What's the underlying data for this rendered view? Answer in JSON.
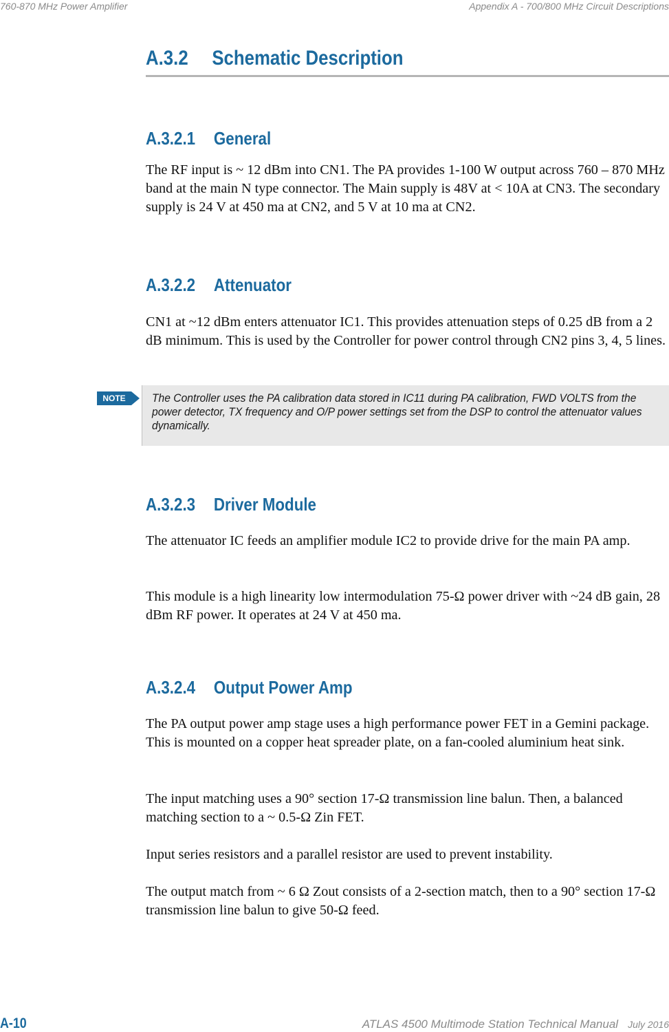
{
  "header": {
    "left": "760-870 MHz Power Amplifier",
    "right": "Appendix A - 700/800 MHz Circuit Descriptions"
  },
  "section": {
    "number": "A.3.2",
    "title": "Schematic Description"
  },
  "subsections": [
    {
      "number": "A.3.2.1",
      "title": "General",
      "paragraphs": [
        "The RF input is ~ 12 dBm into CN1. The PA provides 1-100 W output across 760 – 870 MHz band at the main N type connector. The Main supply is 48V at < 10A at CN3. The secondary supply is 24 V at 450 ma at CN2, and 5 V at 10 ma at CN2."
      ]
    },
    {
      "number": "A.3.2.2",
      "title": "Attenuator",
      "paragraphs": [
        "CN1 at ~12 dBm enters attenuator IC1. This provides attenuation steps of 0.25 dB from a 2 dB minimum. This is used by the Controller for power control through CN2 pins 3, 4, 5 lines."
      ],
      "note": {
        "label": "NOTE",
        "text": "The Controller uses the PA calibration data stored in IC11 during PA calibration, FWD VOLTS from the power detector, TX frequency and O/P power settings set from the DSP to control the attenuator values dynamically."
      }
    },
    {
      "number": "A.3.2.3",
      "title": "Driver Module",
      "paragraphs": [
        "The attenuator IC feeds an amplifier module IC2 to provide drive for the main PA amp.",
        "This module is a high linearity low intermodulation 75-Ω power driver with ~24 dB gain, 28 dBm RF power. It operates at 24 V at 450 ma."
      ]
    },
    {
      "number": "A.3.2.4",
      "title": "Output Power Amp",
      "paragraphs": [
        "The PA output power amp stage uses a high performance power FET in a Gemini package. This is mounted on a copper heat spreader plate, on a fan-cooled aluminium heat sink.",
        "The input matching uses a 90° section 17-Ω transmission line balun. Then, a balanced matching section to a ~ 0.5-Ω Zin FET.",
        "Input series resistors and a parallel resistor are used to prevent instability.",
        "The output match from ~ 6 Ω Zout consists of a 2-section match, then to a 90° section 17-Ω transmission line balun to give 50-Ω feed."
      ]
    }
  ],
  "footer": {
    "page": "A-10",
    "manual_title": "ATLAS 4500 Multimode Station Technical Manual",
    "date": "July 2016"
  },
  "colors": {
    "heading_blue": "#1c6a9e",
    "header_gray": "#8a8a8a",
    "note_background": "#e8e8e8"
  }
}
